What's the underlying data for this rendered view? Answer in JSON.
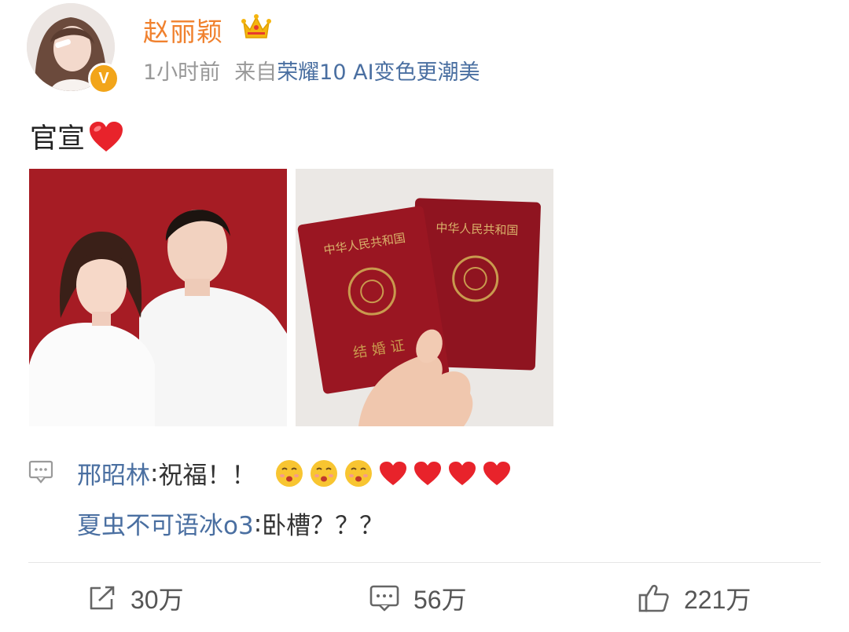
{
  "post": {
    "author": {
      "name": "赵丽颖",
      "verified_badge": "V",
      "crown_icon": "crown-icon"
    },
    "meta": {
      "time": "1小时前",
      "source_label": "来自",
      "device": "荣耀10 AI变色更潮美"
    },
    "text": "官宣",
    "text_emoji": "red-heart-icon",
    "photos": [
      {
        "name": "couple-photo"
      },
      {
        "name": "marriage-certificates-photo",
        "certificate_header": "中华人民共和国",
        "certificate_title": "结婚证"
      }
    ]
  },
  "comments": [
    {
      "user": "邢昭林",
      "text": "祝福！！",
      "emojis": [
        "kissing-face-icon",
        "kissing-face-icon",
        "kissing-face-icon",
        "red-heart-icon",
        "red-heart-icon",
        "red-heart-icon",
        "red-heart-icon"
      ]
    },
    {
      "user": "夏虫不可语冰o3",
      "text": "卧槽？？？"
    }
  ],
  "actions": {
    "repost_count": "30万",
    "comment_count": "56万",
    "like_count": "221万"
  },
  "colors": {
    "username": "#f0812e",
    "link": "#4a6fa1",
    "meta": "#999999",
    "heart": "#e8232b",
    "badge": "#f2a51a"
  }
}
